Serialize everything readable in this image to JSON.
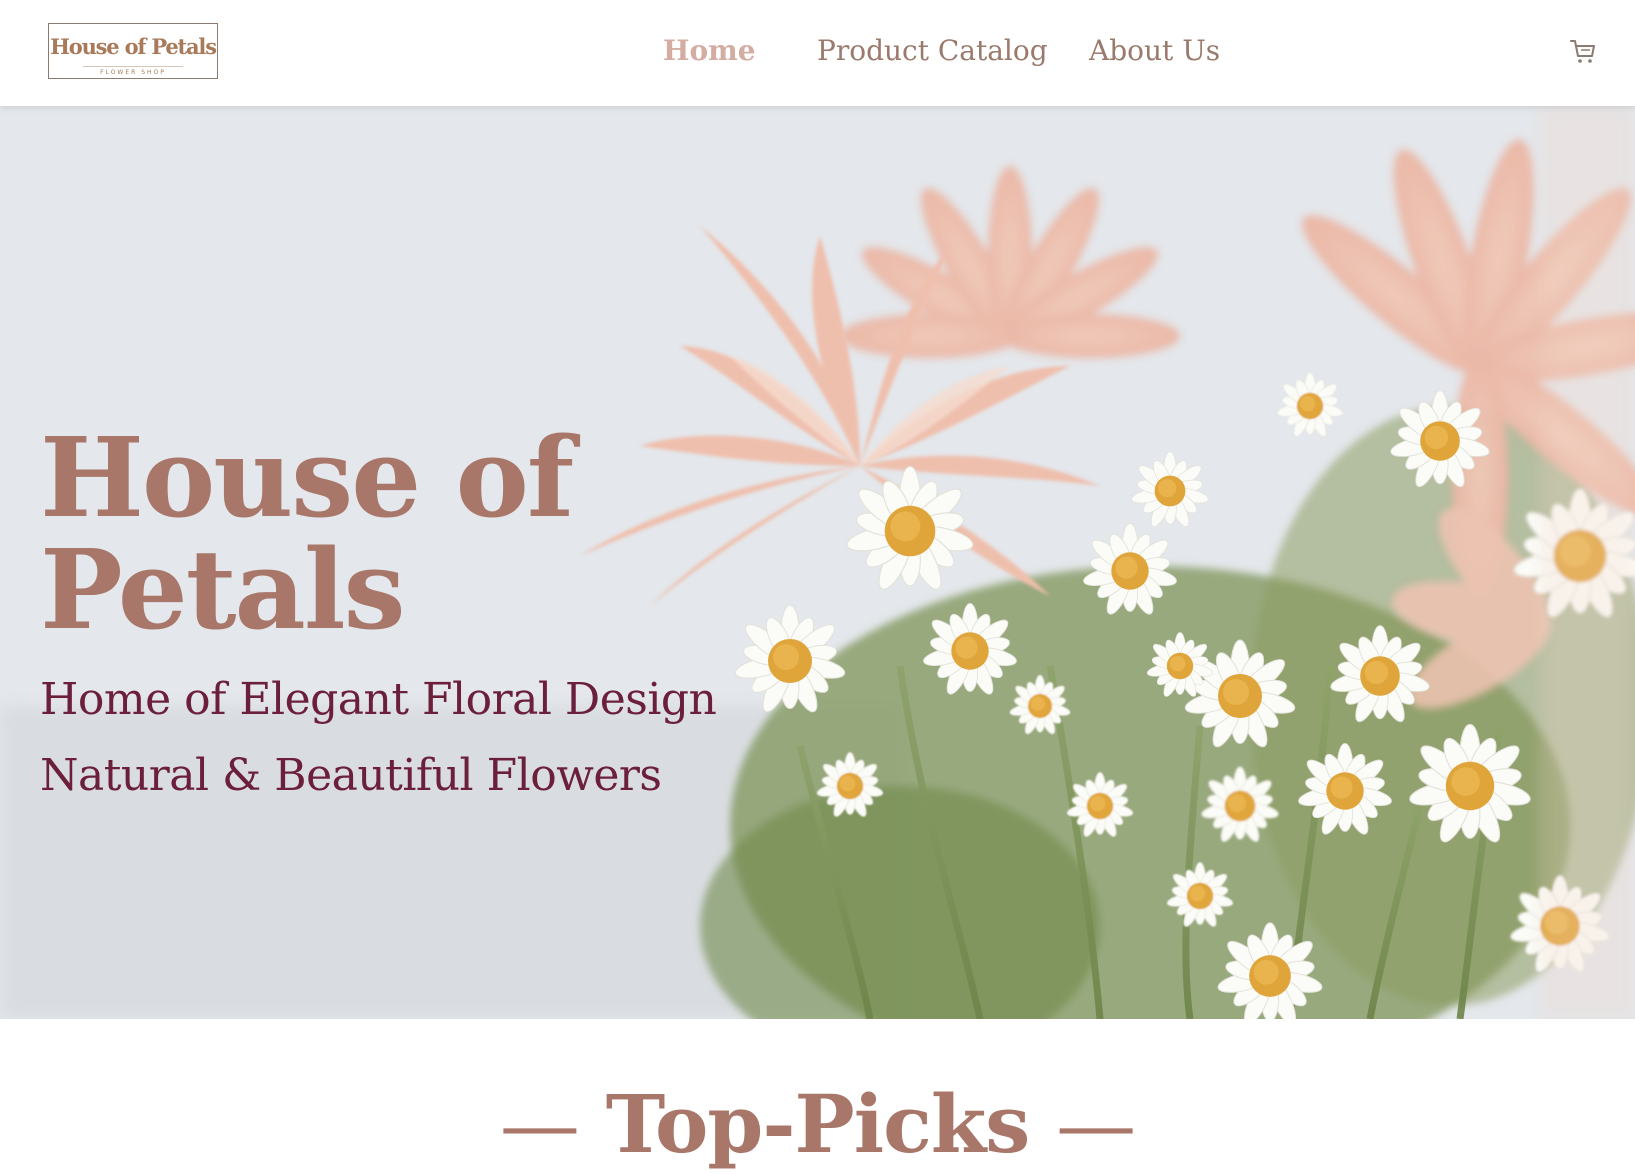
{
  "header": {
    "logo": {
      "title": "House of Petals",
      "subtitle": "FLOWER SHOP"
    },
    "nav": [
      {
        "label": "Home",
        "active": true
      },
      {
        "label": "Product Catalog",
        "active": false
      },
      {
        "label": "About Us",
        "active": false
      }
    ],
    "cart_icon": "shopping-cart-icon"
  },
  "hero": {
    "title_line1": "House of",
    "title_line2": "Petals",
    "tagline1": "Home of Elegant Floral Design",
    "tagline2": "Natural & Beautiful Flowers"
  },
  "section": {
    "dash_left": "—",
    "title": "Top-Picks",
    "dash_right": "—"
  },
  "colors": {
    "accent": "#a87769",
    "nav_active": "#d3ada1",
    "nav_text": "#9a7a6c",
    "tagline": "#6b1f3b"
  }
}
